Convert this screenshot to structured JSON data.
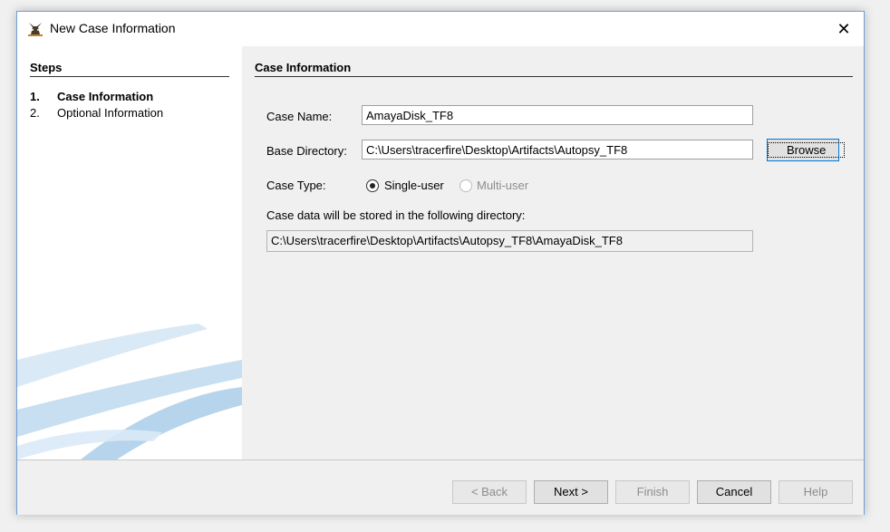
{
  "window": {
    "title": "New Case Information",
    "close_glyph": "✕"
  },
  "steps": {
    "heading": "Steps",
    "items": [
      {
        "num": "1.",
        "label": "Case Information"
      },
      {
        "num": "2.",
        "label": "Optional Information"
      }
    ]
  },
  "content": {
    "heading": "Case Information",
    "case_name_label": "Case Name:",
    "case_name_value": "AmayaDisk_TF8",
    "base_dir_label": "Base Directory:",
    "base_dir_value": "C:\\Users\\tracerfire\\Desktop\\Artifacts\\Autopsy_TF8",
    "browse_label": "Browse",
    "case_type_label": "Case Type:",
    "single_user_label": "Single-user",
    "multi_user_label": "Multi-user",
    "storage_label": "Case data will be stored in the following directory:",
    "storage_value": "C:\\Users\\tracerfire\\Desktop\\Artifacts\\Autopsy_TF8\\AmayaDisk_TF8"
  },
  "buttons": {
    "back": "< Back",
    "next": "Next >",
    "finish": "Finish",
    "cancel": "Cancel",
    "help": "Help"
  },
  "colors": {
    "window_border": "#6fa0d8",
    "focus": "#0078d7",
    "swoosh": "#a9cde8"
  }
}
